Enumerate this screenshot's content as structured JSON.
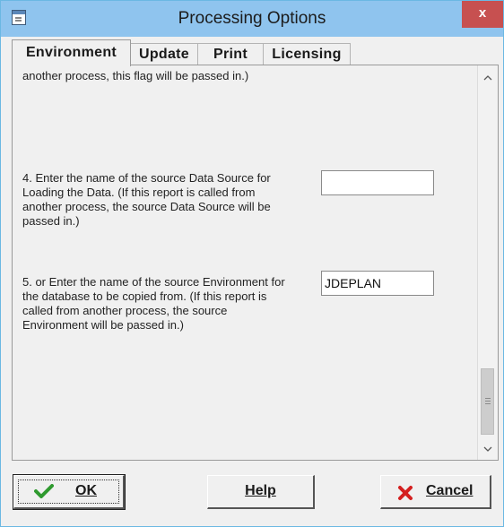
{
  "window": {
    "title": "Processing Options",
    "close_glyph": "x"
  },
  "tabs": [
    {
      "label": "Environment",
      "active": true
    },
    {
      "label": "Update",
      "active": false
    },
    {
      "label": "Print",
      "active": false
    },
    {
      "label": "Licensing",
      "active": false
    }
  ],
  "options": {
    "item3_tail": "another process, this flag will be passed in.)",
    "item4": {
      "prompt": "4.  Enter the name of the source Data Source for Loading the Data.  (If this report is called from another process, the source Data Source will be passed in.)",
      "value": ""
    },
    "item5": {
      "prompt": "5.  or Enter the name of the source Environment for the database to be copied from.  (If this report is called from another process, the source Environment will be passed in.)",
      "value": "JDEPLAN"
    }
  },
  "scrollbar": {
    "up_glyph": "^",
    "down_glyph": "v"
  },
  "buttons": {
    "ok": "OK",
    "help": "Help",
    "cancel": "Cancel"
  },
  "icons": {
    "ok": "check-icon",
    "cancel": "red-x-icon",
    "app": "window-app-icon"
  },
  "colors": {
    "titlebar": "#8fc4ee",
    "close": "#c75050",
    "check": "#2f9a2f",
    "cancel_x": "#d42020"
  }
}
